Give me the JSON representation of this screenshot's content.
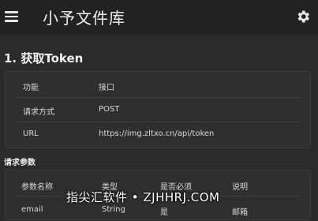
{
  "appbar": {
    "title": "小予文件库",
    "menu_icon": "menu-icon",
    "settings_icon": "gear-icon"
  },
  "section": {
    "title": "1. 获取Token"
  },
  "info_rows": [
    {
      "key": "功能",
      "value": "接口"
    },
    {
      "key": "请求方式",
      "value": "POST"
    },
    {
      "key": "URL",
      "value": "https://img.zltxo.cn/api/token"
    }
  ],
  "params": {
    "title": "请求参数",
    "headers": [
      "参数名称",
      "类型",
      "是否必须",
      "说明"
    ],
    "rows": [
      [
        "email",
        "String",
        "是",
        "邮箱"
      ]
    ]
  },
  "watermark": "指尖汇软件 • ZJHHRJ.COM",
  "colors": {
    "background": "#2b2b2b",
    "appbar": "#222222",
    "card": "#2f2f2f"
  }
}
